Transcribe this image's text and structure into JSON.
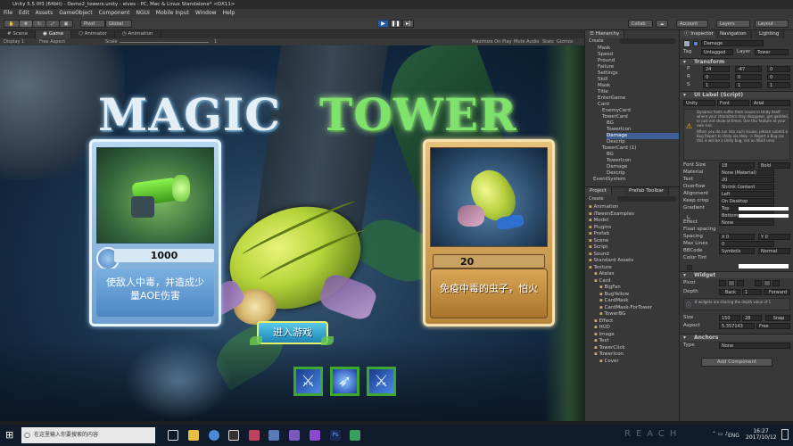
{
  "window": {
    "title": "Unity 5.5.0f3 (64bit) - Demo2_towers.unity - elves - PC, Mac & Linux Standalone* <DX11>"
  },
  "menu": [
    "File",
    "Edit",
    "Assets",
    "GameObject",
    "Component",
    "NGUI",
    "Mobile Input",
    "Window",
    "Help"
  ],
  "toolbar": {
    "pivot": "Pivot",
    "global": "Global",
    "collab": "Collab",
    "account": "Account",
    "layers": "Layers",
    "layout": "Layout"
  },
  "game_view": {
    "tabs": [
      "Scene",
      "Game",
      "Animator",
      "Animation"
    ],
    "display": "Display 1",
    "aspect": "Free Aspect",
    "scale_label": "Scale",
    "scale_value": "1",
    "options": [
      "Maximize On Play",
      "Mute Audio",
      "Stats",
      "Gizmos"
    ]
  },
  "game": {
    "title_left": "MAGIC",
    "title_right": "TOWER",
    "card_left": {
      "value": "1000",
      "desc_line1": "使敌人中毒，并造成少",
      "desc_line2": "量AOE伤害"
    },
    "card_right": {
      "value": "20",
      "desc": "免疫中毒的虫子，怕火"
    },
    "enter_button": "进入游戏"
  },
  "hierarchy": {
    "tab": "Hierarchy",
    "create": "Create",
    "items": [
      "Mask",
      "Speed",
      "Pround",
      "Failure",
      "Settings",
      "Skill",
      "Mask",
      "Title",
      "EnterGame",
      "Card",
      "EnemyCard",
      "TowerCard",
      "BG",
      "TowerIcon",
      "Damage",
      "Descrip",
      "TowerCard (1)",
      "BG",
      "TowerIcon",
      "Damage",
      "Descrip",
      "EventSystem"
    ]
  },
  "project": {
    "tabs": [
      "Project",
      "Prefab Toolbar"
    ],
    "create": "Create",
    "items": [
      "Animation",
      "iTweenExamples",
      "Model",
      "Plugins",
      "Prefab",
      "Scene",
      "Script",
      "Sound",
      "Standard Assets",
      "Texture",
      "Atalas",
      "Card",
      "BigFan",
      "BugYellow",
      "CardMask",
      "CardMask-ForTower",
      "TowerBG",
      "Effect",
      "HUD",
      "Image",
      "Text",
      "TowerClick",
      "TowerIcon",
      "Cover"
    ]
  },
  "inspector": {
    "tabs": [
      "Inspector",
      "Navigation",
      "Lighting"
    ],
    "object_name": "Damage",
    "tag_label": "Tag",
    "tag_value": "Untagged",
    "layer_label": "Layer",
    "layer_value": "Tower",
    "transform_title": "Transform",
    "position": {
      "label": "P",
      "x": "24",
      "y": "-47",
      "z": "0"
    },
    "rotation": {
      "label": "R",
      "x": "0",
      "y": "0",
      "z": "0"
    },
    "scale": {
      "label": "S",
      "x": "1",
      "y": "1",
      "z": "1"
    },
    "uilabel_title": "UI Label (Script)",
    "font_type": "Unity",
    "font_kind": "Font",
    "font_name": "Arial",
    "warning": "Dynamic fonts suffer from issues in Unity itself where your characters may disappear, get garbled, or just not show at times. Use this feature at your own risk.",
    "warning2": "When you do run into such issues, please submit a Bug Report to Unity via Help -> Report a Bug (as this is will be a Unity bug, not an NGUI one).",
    "rows": [
      {
        "label": "Font Size",
        "value": "18",
        "extra": "Bold"
      },
      {
        "label": "Material",
        "value": "None (Material)"
      },
      {
        "label": "Text",
        "value": "20"
      },
      {
        "label": "Overflow",
        "value": "Shrink Content"
      },
      {
        "label": "Alignment",
        "value": "Left"
      },
      {
        "label": "Keep crisp",
        "value": "On Desktop"
      },
      {
        "label": "Gradient",
        "value": "Top"
      },
      {
        "label": "",
        "value": "Bottom"
      },
      {
        "label": "Effect",
        "value": "None"
      },
      {
        "label": "Float spacing",
        "value": ""
      },
      {
        "label": "Spacing",
        "value": "X 0",
        "extra": "Y 0"
      },
      {
        "label": "Max Lines",
        "value": "0"
      },
      {
        "label": "BBCode",
        "value": "Symbols",
        "extra": "Normal"
      },
      {
        "label": "Color Tint",
        "value": ""
      }
    ],
    "widget_title": "Widget",
    "pivot_label": "Pivot",
    "depth_label": "Depth",
    "depth_back": "Back",
    "depth_value": "1",
    "depth_forward": "Forward",
    "depth_note": "8 widgets are sharing the depth value of 1",
    "size_label": "Size",
    "size_w": "150",
    "size_h": "28",
    "snap": "Snap",
    "aspect_label": "Aspect",
    "aspect_value": "5.357143",
    "aspect_mode": "Free",
    "anchors_title": "Anchors",
    "anchor_type_label": "Type",
    "anchor_type_value": "None",
    "add_component": "Add Component"
  },
  "taskbar": {
    "search": "在这里输入你要搜索的内容",
    "watermark": "REACH",
    "lang": "ENG",
    "time": "16:27",
    "date": "2017/10/12"
  },
  "colors": {
    "accent": "#2a5a9c",
    "title_green": "#7ee36a",
    "card_blue": "#5a8fc8",
    "card_gold": "#c89a4a"
  }
}
